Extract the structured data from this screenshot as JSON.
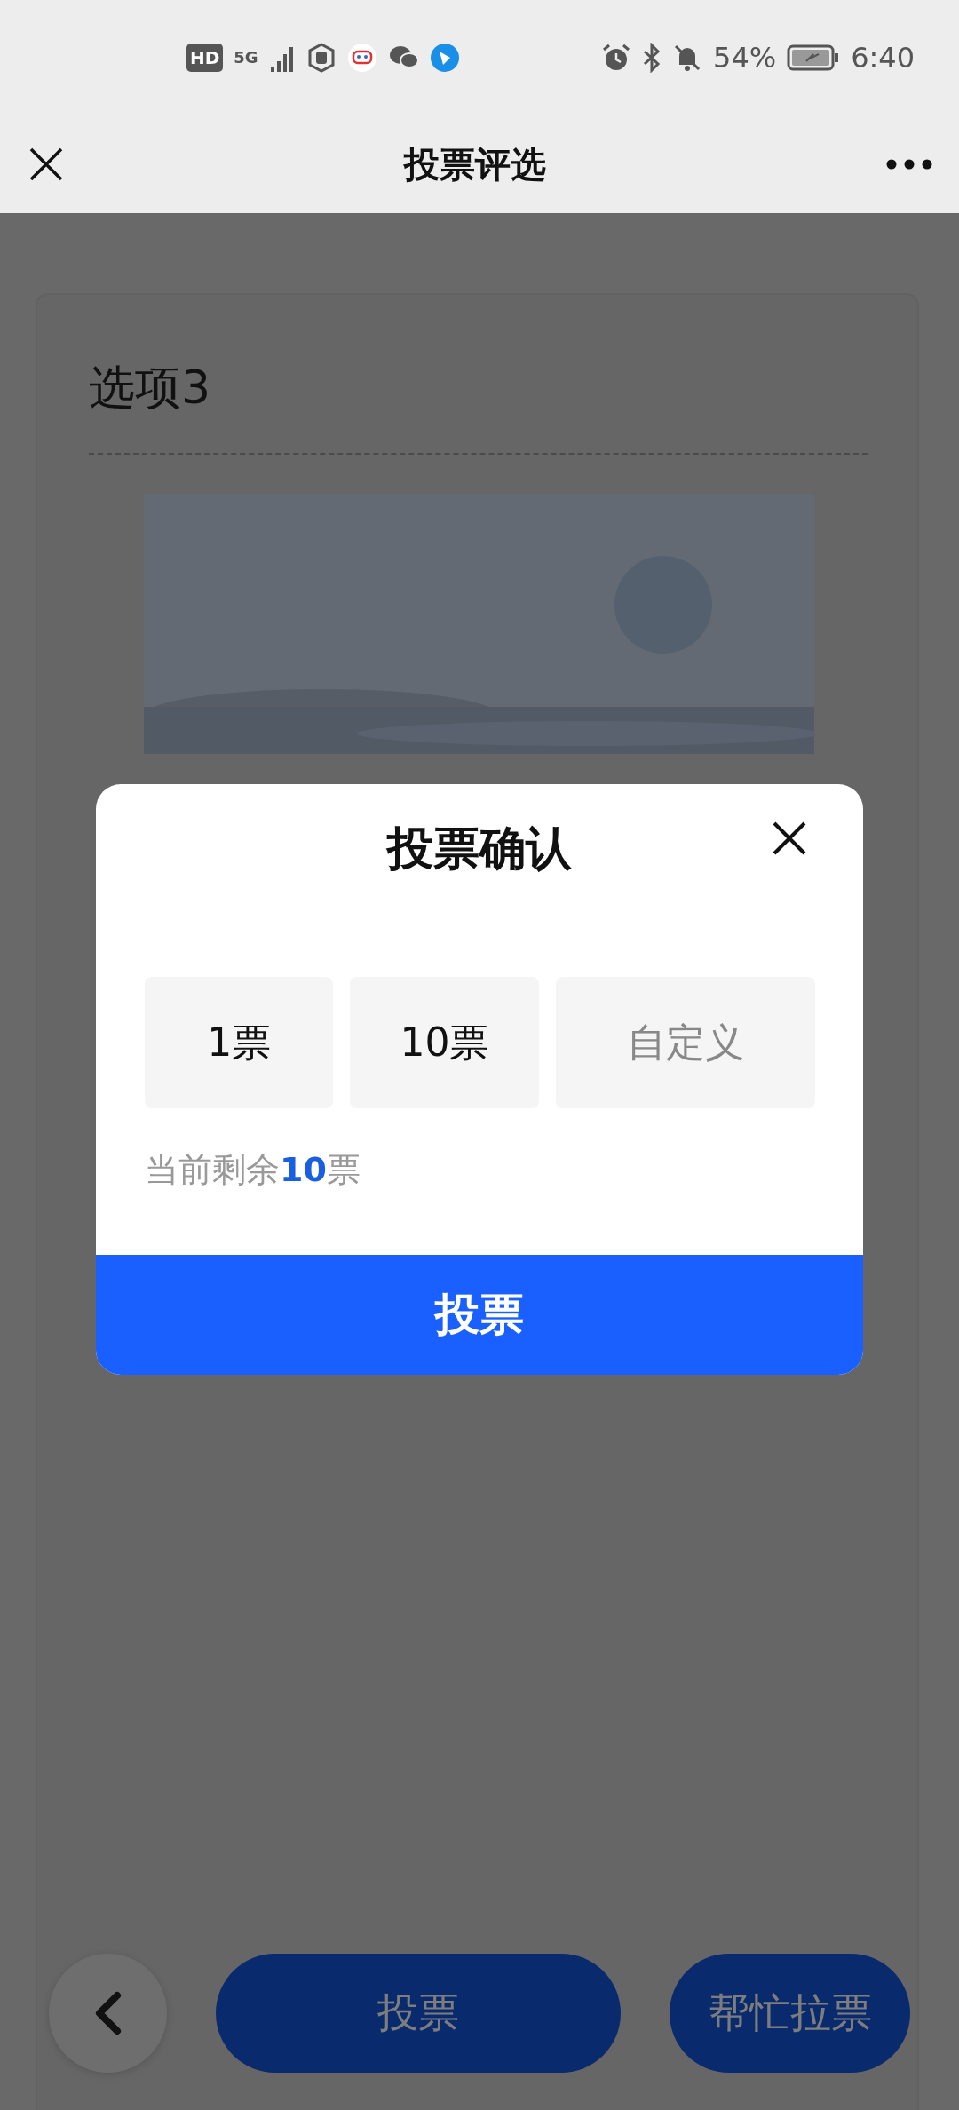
{
  "status_bar": {
    "left_badges": [
      "HD",
      "5G"
    ],
    "battery": "54%",
    "time": "6:40"
  },
  "nav_bar": {
    "title": "投票评选"
  },
  "card": {
    "title": "选项3"
  },
  "dialog": {
    "title": "投票确认",
    "options": [
      {
        "label": "1票",
        "kind": "preset"
      },
      {
        "label": "10票",
        "kind": "preset"
      },
      {
        "label": "自定义",
        "kind": "custom"
      }
    ],
    "remaining": "当前剩余**10**票",
    "submit": "投票"
  },
  "bottom_bar": {
    "vote": "投票",
    "canvass": "帮忙拉票"
  }
}
